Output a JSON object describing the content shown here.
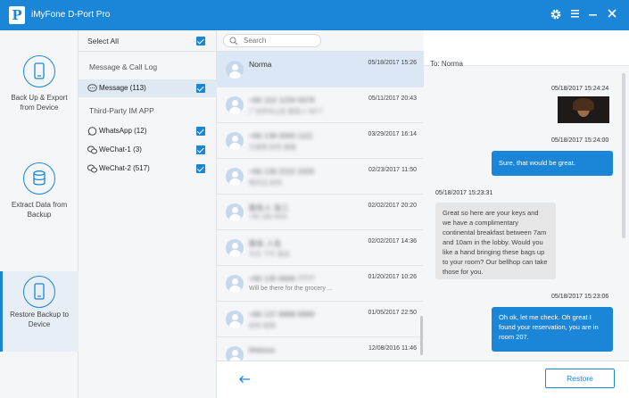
{
  "app": {
    "logo_letter": "P",
    "title": "iMyFone D-Port Pro",
    "accent_color": "#1b86d8"
  },
  "titlebar_icons": [
    "gear-icon",
    "menu-icon",
    "minimize-icon",
    "close-icon"
  ],
  "leftnav": {
    "items": [
      {
        "label": "Back Up & Export from Device",
        "icon": "phone-sync-icon",
        "active": false
      },
      {
        "label": "Extract Data from Backup",
        "icon": "database-icon",
        "active": false
      },
      {
        "label": "Restore Backup to Device",
        "icon": "phone-restore-icon",
        "active": true
      }
    ]
  },
  "categories": {
    "select_all_label": "Select All",
    "section1_title": "Message & Call Log",
    "section1_items": [
      {
        "label": "Message (113)",
        "icon": "message-icon",
        "checked": true,
        "active": true
      }
    ],
    "section2_title": "Third-Party IM APP",
    "section2_items": [
      {
        "label": "WhatsApp (12)",
        "icon": "whatsapp-icon",
        "checked": true
      },
      {
        "label": "WeChat-1 (3)",
        "icon": "wechat-icon",
        "checked": true
      },
      {
        "label": "WeChat-2 (517)",
        "icon": "wechat-icon",
        "checked": true
      }
    ]
  },
  "search": {
    "placeholder": "Search"
  },
  "conversations": [
    {
      "name": "Norma",
      "subtitle": "",
      "date": "05/18/2017 15:26"
    },
    {
      "name": "+86 152 1234 5678",
      "subtitle": "广州市中心区 联系人 5677",
      "date": "05/11/2017 20:43"
    },
    {
      "name": "+86 138 0000 1111",
      "subtitle": "已收到 好的 谢谢",
      "date": "03/29/2017 16:14"
    },
    {
      "name": "+86 139 2222 3333",
      "subtitle": "明天见 好的",
      "date": "02/23/2017 11:50"
    },
    {
      "name": "联系人 张三",
      "subtitle": "+86 188 4444",
      "date": "02/02/2017 20:20"
    },
    {
      "name": "联系 人名",
      "subtitle": "今天 下午 到达",
      "date": "02/02/2017 14:36"
    },
    {
      "name": "+86 135 6666 7777",
      "subtitle": "Will be there for the grocery ...",
      "date": "01/20/2017 10:26"
    },
    {
      "name": "+86 137 8888 9999",
      "subtitle": "好的 收到",
      "date": "01/05/2017 22:50"
    },
    {
      "name": "Melissa",
      "subtitle": "",
      "date": "12/08/2016 11:46"
    }
  ],
  "chat": {
    "to_label": "To:  Norma",
    "messages": [
      {
        "time": "05/18/2017 15:24:24",
        "direction": "out",
        "type": "image",
        "text": ""
      },
      {
        "time": "05/18/2017 15:24:00",
        "direction": "out",
        "type": "text",
        "text": "Sure, that would be great."
      },
      {
        "time": "05/18/2017 15:23:31",
        "direction": "in",
        "type": "text",
        "text": "Great so here are your keys and we have a complimentary continental breakfast between 7am and 10am in the lobby. Would you like a hand bringing these bags up to your room? Our bellhop can take those for you."
      },
      {
        "time": "05/18/2017 15:23:06",
        "direction": "out",
        "type": "text",
        "text": "Oh ok, let me check. Oh great I found your reservation, you are in room 207."
      }
    ]
  },
  "footer": {
    "restore_label": "Restore",
    "back_icon": "arrow-left-icon"
  }
}
